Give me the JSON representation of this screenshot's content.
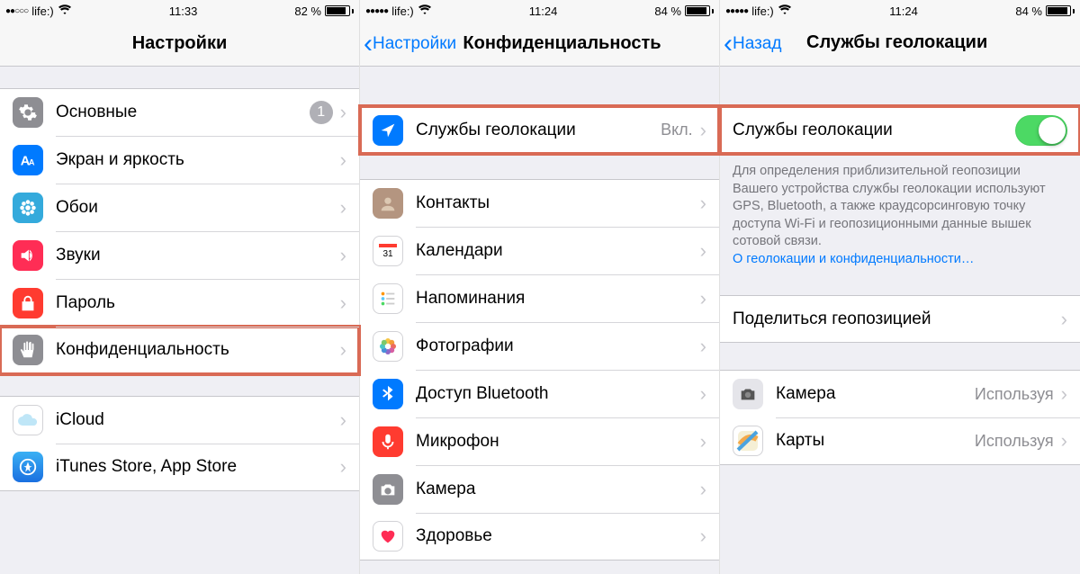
{
  "screens": [
    {
      "status": {
        "carrier": "life:)",
        "time": "11:33",
        "battery_pct": "82 %",
        "battery_fill": 82
      },
      "nav": {
        "title": "Настройки",
        "back": null
      },
      "group1": [
        {
          "label": "Основные",
          "badge": "1"
        },
        {
          "label": "Экран и яркость"
        },
        {
          "label": "Обои"
        },
        {
          "label": "Звуки"
        },
        {
          "label": "Пароль"
        },
        {
          "label": "Конфиденциальность",
          "highlight": true
        }
      ],
      "group2": [
        {
          "label": "iCloud"
        },
        {
          "label": "iTunes Store, App Store"
        }
      ]
    },
    {
      "status": {
        "carrier": "life:)",
        "time": "11:24",
        "battery_pct": "84 %",
        "battery_fill": 84
      },
      "nav": {
        "title": "Конфиденциальность",
        "back": "Настройки"
      },
      "group1": [
        {
          "label": "Службы геолокации",
          "detail": "Вкл.",
          "highlight": true
        }
      ],
      "group2": [
        {
          "label": "Контакты"
        },
        {
          "label": "Календари"
        },
        {
          "label": "Напоминания"
        },
        {
          "label": "Фотографии"
        },
        {
          "label": "Доступ Bluetooth"
        },
        {
          "label": "Микрофон"
        },
        {
          "label": "Камера"
        },
        {
          "label": "Здоровье"
        }
      ]
    },
    {
      "status": {
        "carrier": "life:)",
        "time": "11:24",
        "battery_pct": "84 %",
        "battery_fill": 84
      },
      "nav": {
        "title": "Службы геолокации",
        "back": "Назад"
      },
      "toggle_row": {
        "label": "Службы геолокации",
        "on": true,
        "highlight": true
      },
      "footer": {
        "text": "Для определения приблизительной геопозиции Вашего устройства службы геолокации используют GPS, Bluetooth, а также краудсорсинговую точку доступа Wi-Fi и геопозиционными данные вышек сотовой связи.",
        "link": "О геолокации и конфиденциальности…"
      },
      "share_row": {
        "label": "Поделиться геопозицией"
      },
      "apps": [
        {
          "label": "Камера",
          "detail": "Используя"
        },
        {
          "label": "Карты",
          "detail": "Используя"
        }
      ]
    }
  ]
}
